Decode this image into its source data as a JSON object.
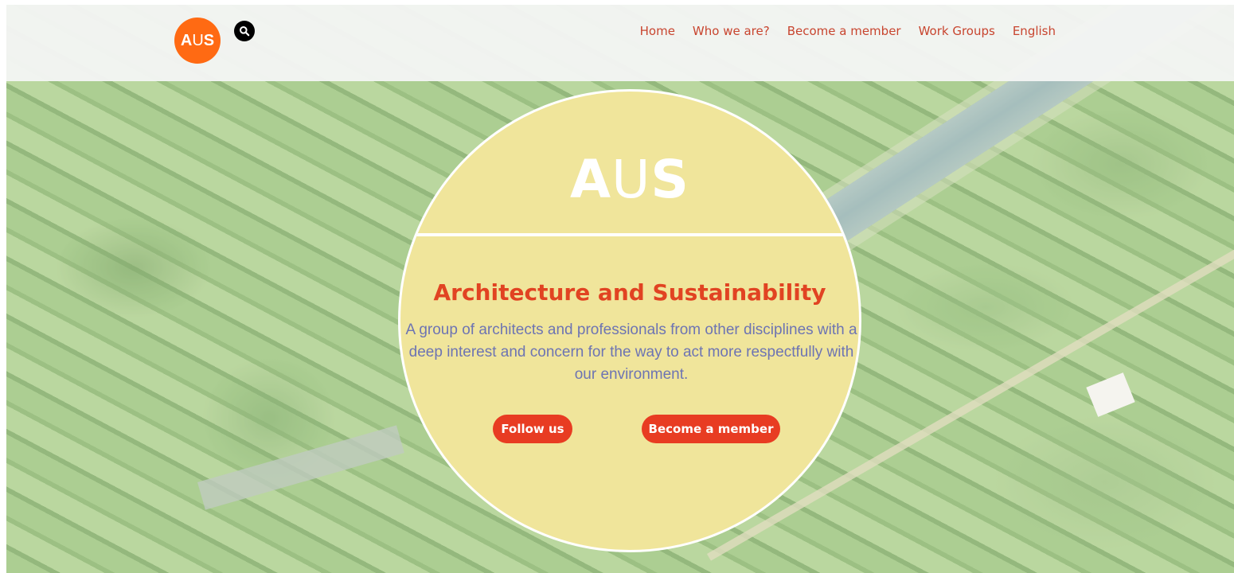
{
  "header": {
    "logo_text_a": "A",
    "logo_text_u": "U",
    "logo_text_s": "S",
    "nav": [
      {
        "label": "Home"
      },
      {
        "label": "Who we are?"
      },
      {
        "label": "Become a member"
      },
      {
        "label": "Work Groups"
      },
      {
        "label": "English"
      }
    ]
  },
  "hero": {
    "logo_a": "A",
    "logo_u": "U",
    "logo_s": "S",
    "title": "Architecture and Sustainability",
    "description": "A group of architects and professionals from other disciplines with a deep interest and concern for the way to act more respectfully with our environment.",
    "buttons": {
      "follow": "Follow us",
      "member": "Become a member"
    }
  },
  "colors": {
    "logo_orange": "#ff6a13",
    "nav_link": "#c8452f",
    "circle_fill": "#f0e59b",
    "title_red": "#e14322",
    "description_blue": "#6d74b3",
    "button_red": "#e83c22"
  },
  "icons": {
    "search": "search-icon"
  }
}
